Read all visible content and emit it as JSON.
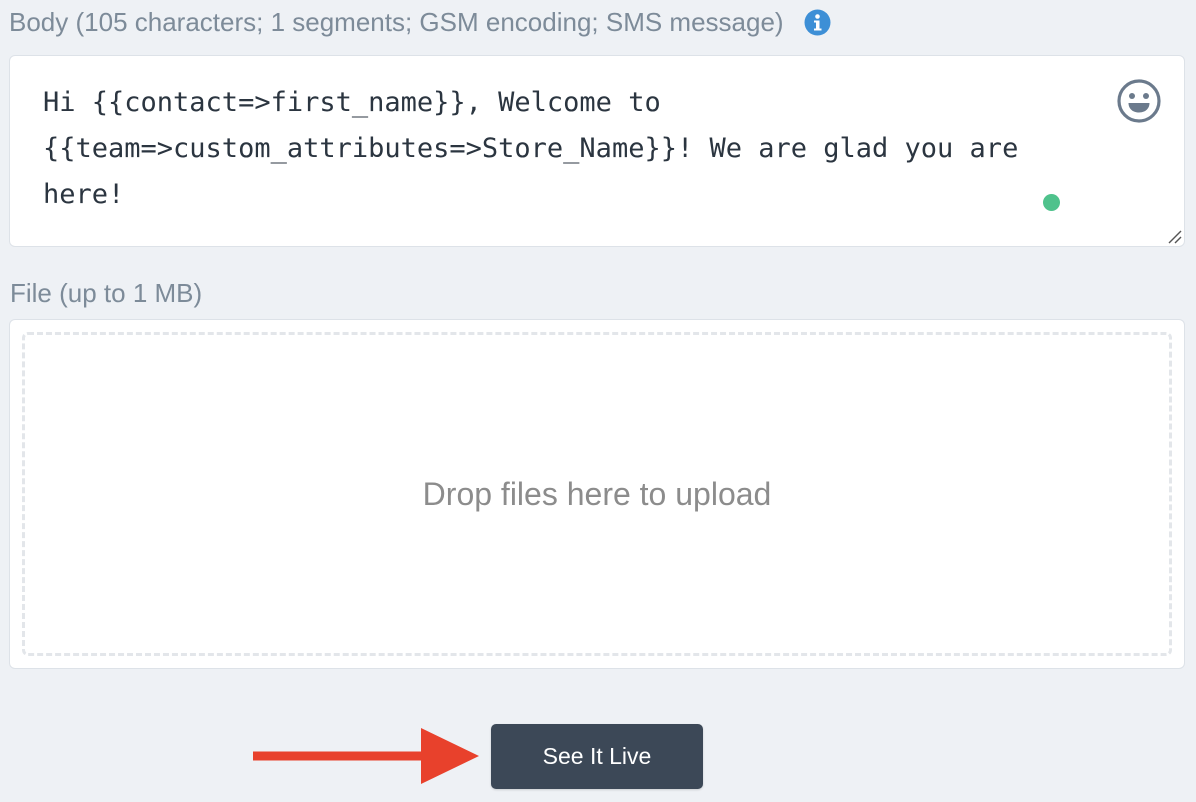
{
  "body": {
    "label": "Body (105 characters; 1 segments; GSM encoding; SMS message)",
    "info_icon": "info-circle-icon",
    "value": "Hi {{contact=>first_name}}, Welcome to\n{{team=>custom_attributes=>Store_Name}}! We are glad you are here!",
    "emoji_icon": "smiley-face-icon",
    "status_color": "#4fc28c"
  },
  "file": {
    "label": "File (up to 1 MB)",
    "dropzone_text": "Drop files here to upload"
  },
  "actions": {
    "see_it_live_label": "See It Live",
    "button_color": "#3c4857",
    "arrow_color": "#e8412c"
  },
  "colors": {
    "background": "#eef1f5",
    "info_icon": "#3d8fd6",
    "label_text": "#7d8b99"
  }
}
